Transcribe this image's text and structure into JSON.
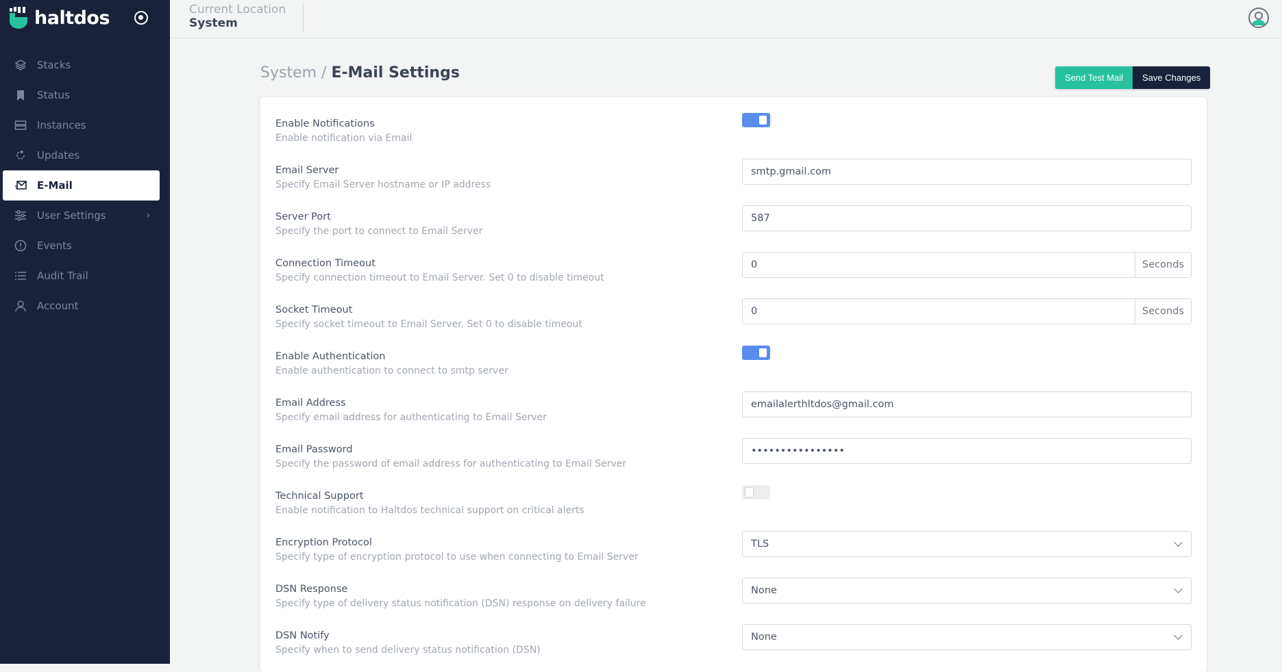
{
  "app": {
    "logo_text": "haltdos"
  },
  "sidebar": {
    "items": [
      {
        "label": "Stacks",
        "icon": "layers-icon"
      },
      {
        "label": "Status",
        "icon": "bookmark-icon"
      },
      {
        "label": "Instances",
        "icon": "server-icon"
      },
      {
        "label": "Updates",
        "icon": "refresh-icon"
      },
      {
        "label": "E-Mail",
        "icon": "mail-icon",
        "active": true
      },
      {
        "label": "User Settings",
        "icon": "sliders-icon",
        "has_submenu": true
      },
      {
        "label": "Events",
        "icon": "alert-circle-icon"
      },
      {
        "label": "Audit Trail",
        "icon": "list-icon"
      },
      {
        "label": "Account",
        "icon": "user-icon"
      }
    ]
  },
  "header": {
    "location_label": "Current Location",
    "location_value": "System"
  },
  "page": {
    "breadcrumb_parent": "System /",
    "title": "E-Mail Settings",
    "send_test": "Send Test Mail",
    "save": "Save Changes"
  },
  "colors": {
    "sidebar": "#19223a",
    "accent": "#26c29e",
    "toggle_on": "#5b8def"
  },
  "settings": [
    {
      "label": "Enable Notifications",
      "desc": "Enable notification via Email",
      "type": "toggle",
      "on": true
    },
    {
      "label": "Email Server",
      "desc": "Specify Email Server hostname or IP address",
      "type": "input",
      "value": "smtp.gmail.com"
    },
    {
      "label": "Server Port",
      "desc": "Specify the port to connect to Email Server",
      "type": "input",
      "value": "587"
    },
    {
      "label": "Connection Timeout",
      "desc": "Specify connection timeout to Email Server. Set 0 to disable timeout",
      "type": "input",
      "value": "0",
      "suffix": "Seconds"
    },
    {
      "label": "Socket Timeout",
      "desc": "Specify socket timeout to Email Server. Set 0 to disable timeout",
      "type": "input",
      "value": "0",
      "suffix": "Seconds"
    },
    {
      "label": "Enable Authentication",
      "desc": "Enable authentication to connect to smtp server",
      "type": "toggle",
      "on": true
    },
    {
      "label": "Email Address",
      "desc": "Specify email address for authenticating to Email Server",
      "type": "input",
      "value": "emailalerthltdos@gmail.com"
    },
    {
      "label": "Email Password",
      "desc": "Specify the password of email address for authenticating to Email Server",
      "type": "input",
      "value": "••••••••••••••••"
    },
    {
      "label": "Technical Support",
      "desc": "Enable notification to Haltdos technical support on critical alerts",
      "type": "toggle",
      "on": false
    },
    {
      "label": "Encryption Protocol",
      "desc": "Specify type of encryption protocol to use when connecting to Email Server",
      "type": "select",
      "value": "TLS"
    },
    {
      "label": "DSN Response",
      "desc": "Specify type of delivery status notification (DSN) response on delivery failure",
      "type": "select",
      "value": "None"
    },
    {
      "label": "DSN Notify",
      "desc": "Specify when to send delivery status notification (DSN)",
      "type": "select",
      "value": "None"
    }
  ]
}
